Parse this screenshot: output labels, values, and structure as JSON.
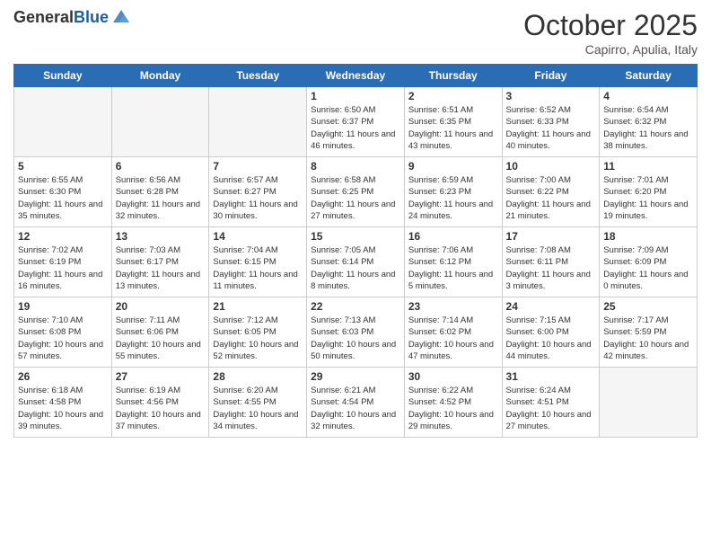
{
  "header": {
    "logo_general": "General",
    "logo_blue": "Blue",
    "month": "October 2025",
    "location": "Capirro, Apulia, Italy"
  },
  "weekdays": [
    "Sunday",
    "Monday",
    "Tuesday",
    "Wednesday",
    "Thursday",
    "Friday",
    "Saturday"
  ],
  "weeks": [
    [
      {
        "day": "",
        "info": "",
        "empty": true
      },
      {
        "day": "",
        "info": "",
        "empty": true
      },
      {
        "day": "",
        "info": "",
        "empty": true
      },
      {
        "day": "1",
        "info": "Sunrise: 6:50 AM\nSunset: 6:37 PM\nDaylight: 11 hours and 46 minutes."
      },
      {
        "day": "2",
        "info": "Sunrise: 6:51 AM\nSunset: 6:35 PM\nDaylight: 11 hours and 43 minutes."
      },
      {
        "day": "3",
        "info": "Sunrise: 6:52 AM\nSunset: 6:33 PM\nDaylight: 11 hours and 40 minutes."
      },
      {
        "day": "4",
        "info": "Sunrise: 6:54 AM\nSunset: 6:32 PM\nDaylight: 11 hours and 38 minutes."
      }
    ],
    [
      {
        "day": "5",
        "info": "Sunrise: 6:55 AM\nSunset: 6:30 PM\nDaylight: 11 hours and 35 minutes."
      },
      {
        "day": "6",
        "info": "Sunrise: 6:56 AM\nSunset: 6:28 PM\nDaylight: 11 hours and 32 minutes."
      },
      {
        "day": "7",
        "info": "Sunrise: 6:57 AM\nSunset: 6:27 PM\nDaylight: 11 hours and 30 minutes."
      },
      {
        "day": "8",
        "info": "Sunrise: 6:58 AM\nSunset: 6:25 PM\nDaylight: 11 hours and 27 minutes."
      },
      {
        "day": "9",
        "info": "Sunrise: 6:59 AM\nSunset: 6:23 PM\nDaylight: 11 hours and 24 minutes."
      },
      {
        "day": "10",
        "info": "Sunrise: 7:00 AM\nSunset: 6:22 PM\nDaylight: 11 hours and 21 minutes."
      },
      {
        "day": "11",
        "info": "Sunrise: 7:01 AM\nSunset: 6:20 PM\nDaylight: 11 hours and 19 minutes."
      }
    ],
    [
      {
        "day": "12",
        "info": "Sunrise: 7:02 AM\nSunset: 6:19 PM\nDaylight: 11 hours and 16 minutes."
      },
      {
        "day": "13",
        "info": "Sunrise: 7:03 AM\nSunset: 6:17 PM\nDaylight: 11 hours and 13 minutes."
      },
      {
        "day": "14",
        "info": "Sunrise: 7:04 AM\nSunset: 6:15 PM\nDaylight: 11 hours and 11 minutes."
      },
      {
        "day": "15",
        "info": "Sunrise: 7:05 AM\nSunset: 6:14 PM\nDaylight: 11 hours and 8 minutes."
      },
      {
        "day": "16",
        "info": "Sunrise: 7:06 AM\nSunset: 6:12 PM\nDaylight: 11 hours and 5 minutes."
      },
      {
        "day": "17",
        "info": "Sunrise: 7:08 AM\nSunset: 6:11 PM\nDaylight: 11 hours and 3 minutes."
      },
      {
        "day": "18",
        "info": "Sunrise: 7:09 AM\nSunset: 6:09 PM\nDaylight: 11 hours and 0 minutes."
      }
    ],
    [
      {
        "day": "19",
        "info": "Sunrise: 7:10 AM\nSunset: 6:08 PM\nDaylight: 10 hours and 57 minutes."
      },
      {
        "day": "20",
        "info": "Sunrise: 7:11 AM\nSunset: 6:06 PM\nDaylight: 10 hours and 55 minutes."
      },
      {
        "day": "21",
        "info": "Sunrise: 7:12 AM\nSunset: 6:05 PM\nDaylight: 10 hours and 52 minutes."
      },
      {
        "day": "22",
        "info": "Sunrise: 7:13 AM\nSunset: 6:03 PM\nDaylight: 10 hours and 50 minutes."
      },
      {
        "day": "23",
        "info": "Sunrise: 7:14 AM\nSunset: 6:02 PM\nDaylight: 10 hours and 47 minutes."
      },
      {
        "day": "24",
        "info": "Sunrise: 7:15 AM\nSunset: 6:00 PM\nDaylight: 10 hours and 44 minutes."
      },
      {
        "day": "25",
        "info": "Sunrise: 7:17 AM\nSunset: 5:59 PM\nDaylight: 10 hours and 42 minutes."
      }
    ],
    [
      {
        "day": "26",
        "info": "Sunrise: 6:18 AM\nSunset: 4:58 PM\nDaylight: 10 hours and 39 minutes."
      },
      {
        "day": "27",
        "info": "Sunrise: 6:19 AM\nSunset: 4:56 PM\nDaylight: 10 hours and 37 minutes."
      },
      {
        "day": "28",
        "info": "Sunrise: 6:20 AM\nSunset: 4:55 PM\nDaylight: 10 hours and 34 minutes."
      },
      {
        "day": "29",
        "info": "Sunrise: 6:21 AM\nSunset: 4:54 PM\nDaylight: 10 hours and 32 minutes."
      },
      {
        "day": "30",
        "info": "Sunrise: 6:22 AM\nSunset: 4:52 PM\nDaylight: 10 hours and 29 minutes."
      },
      {
        "day": "31",
        "info": "Sunrise: 6:24 AM\nSunset: 4:51 PM\nDaylight: 10 hours and 27 minutes."
      },
      {
        "day": "",
        "info": "",
        "empty": true
      }
    ]
  ]
}
